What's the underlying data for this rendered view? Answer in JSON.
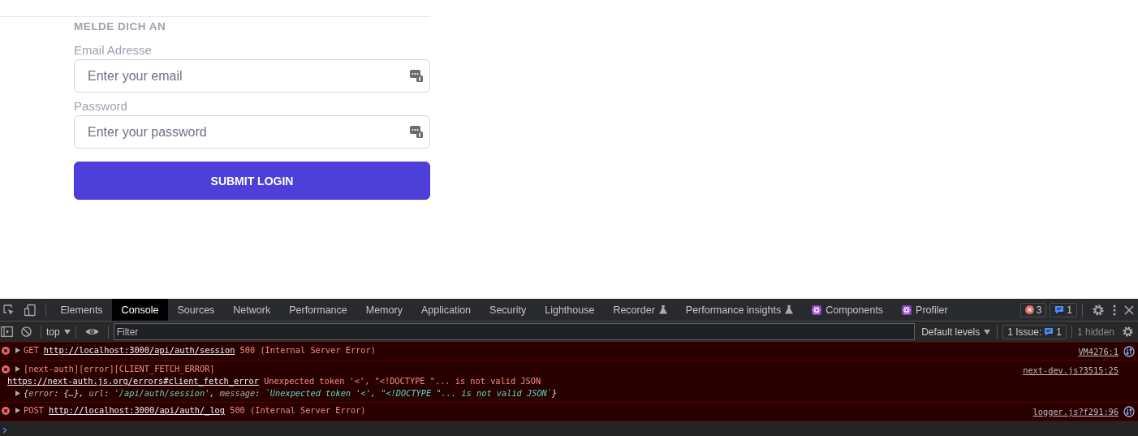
{
  "login": {
    "heading": "MELDE DICH AN",
    "fields": [
      {
        "label": "Email Adresse",
        "placeholder": "Enter your email"
      },
      {
        "label": "Password",
        "placeholder": "Enter your password"
      }
    ],
    "submit": "SUBMIT LOGIN"
  },
  "devtools": {
    "tabs": [
      {
        "label": "Elements",
        "selected": false
      },
      {
        "label": "Console",
        "selected": true
      },
      {
        "label": "Sources",
        "selected": false
      },
      {
        "label": "Network",
        "selected": false
      },
      {
        "label": "Performance",
        "selected": false
      },
      {
        "label": "Memory",
        "selected": false
      },
      {
        "label": "Application",
        "selected": false
      },
      {
        "label": "Security",
        "selected": false
      },
      {
        "label": "Lighthouse",
        "selected": false
      },
      {
        "label": "Recorder",
        "selected": false,
        "kind": "experimental"
      },
      {
        "label": "Performance insights",
        "selected": false,
        "kind": "experimental"
      },
      {
        "label": "Components",
        "selected": false,
        "kind": "extension"
      },
      {
        "label": "Profiler",
        "selected": false,
        "kind": "extension"
      }
    ],
    "error_count": "3",
    "issue_count": "1",
    "toolbar": {
      "context": "top",
      "filter_placeholder": "Filter",
      "levels": "Default levels",
      "issues_label": "1 Issue:",
      "issues_count": "1",
      "hidden": "1 hidden"
    },
    "messages": [
      {
        "source": "VM4276:1",
        "step_icon": true,
        "lines": [
          {
            "expandable": true,
            "parts": [
              {
                "kind": "text",
                "t": "GET "
              },
              {
                "kind": "link",
                "t": "http://localhost:3000/api/auth/session"
              },
              {
                "kind": "text",
                "t": " 500 (Internal Server Error)"
              }
            ]
          }
        ]
      },
      {
        "source": "next-dev.js?3515:25",
        "lines": [
          {
            "expandable": true,
            "parts": [
              {
                "kind": "text",
                "t": "[next-auth][error][CLIENT_FETCH_ERROR]"
              }
            ]
          },
          {
            "parts": [
              {
                "kind": "link",
                "t": "https://next-auth.js.org/errors#client_fetch_error"
              },
              {
                "kind": "text",
                "t": " Unexpected token '<', \"<!DOCTYPE \"... is not valid JSON"
              }
            ]
          },
          {
            "expandable": true,
            "parts": [
              {
                "kind": "punct",
                "t": "{"
              },
              {
                "kind": "key",
                "t": "error"
              },
              {
                "kind": "punct",
                "t": ": {…}, "
              },
              {
                "kind": "key",
                "t": "url"
              },
              {
                "kind": "punct",
                "t": ": "
              },
              {
                "kind": "string",
                "t": "'/api/auth/session'"
              },
              {
                "kind": "punct",
                "t": ", "
              },
              {
                "kind": "key",
                "t": "message"
              },
              {
                "kind": "punct",
                "t": ": "
              },
              {
                "kind": "string",
                "t": "`Unexpected token '<', \"<!DOCTYPE \"... is not valid JSON`"
              },
              {
                "kind": "punct",
                "t": "}"
              }
            ]
          }
        ]
      },
      {
        "source": "logger.js?f291:96",
        "step_icon": true,
        "lines": [
          {
            "expandable": true,
            "parts": [
              {
                "kind": "text",
                "t": "POST "
              },
              {
                "kind": "link",
                "t": "http://localhost:3000/api/auth/_log"
              },
              {
                "kind": "text",
                "t": " 500 (Internal Server Error)"
              }
            ]
          }
        ]
      }
    ]
  }
}
